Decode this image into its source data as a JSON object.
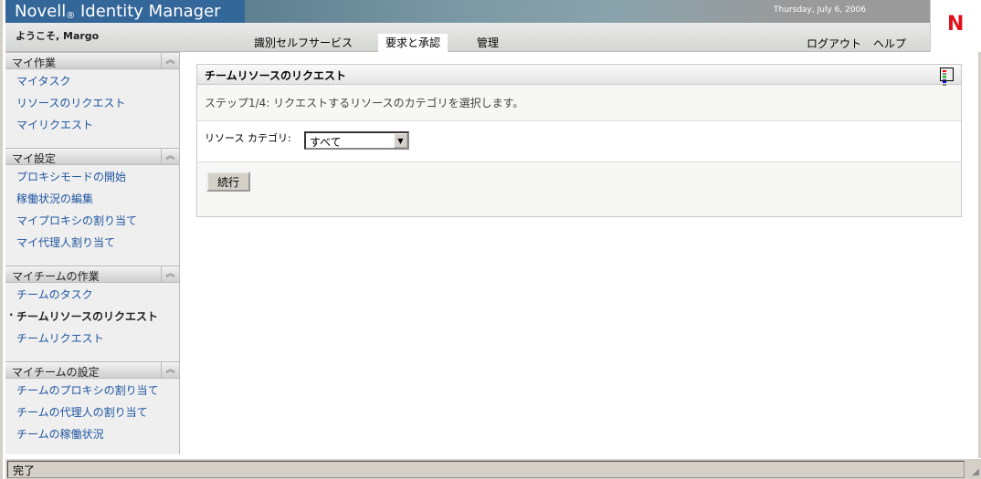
{
  "header": {
    "brand": "Novell",
    "reg": "®",
    "product": "Identity Manager",
    "date": "Thursday, July 6, 2006",
    "logo_letter": "N",
    "welcome": "ようこそ, Margo"
  },
  "tabs": [
    {
      "label": "識別セルフサービス"
    },
    {
      "label": "要求と承認"
    },
    {
      "label": "管理"
    }
  ],
  "toplinks": {
    "logout": "ログアウト",
    "help": "ヘルプ"
  },
  "sidebar": {
    "sections": [
      {
        "title": "マイ作業",
        "items": [
          "マイタスク",
          "リソースのリクエスト",
          "マイリクエスト"
        ]
      },
      {
        "title": "マイ設定",
        "items": [
          "プロキシモードの開始",
          "稼働状況の編集",
          "マイプロキシの割り当て",
          "マイ代理人割り当て"
        ]
      },
      {
        "title": "マイチームの作業",
        "items": [
          "チームのタスク",
          "チームリソースのリクエスト",
          "チームリクエスト"
        ]
      },
      {
        "title": "マイチームの設定",
        "items": [
          "チームのプロキシの割り当て",
          "チームの代理人の割り当て",
          "チームの稼働状況"
        ]
      }
    ],
    "collapse_symbol": "︽"
  },
  "panel": {
    "title": "チームリソースのリクエスト",
    "step": "ステップ1/4: リクエストするリソースのカテゴリを選択します。",
    "category_label": "リソース カテゴリ:",
    "category_value": "すべて",
    "continue": "続行"
  },
  "status": "完了"
}
